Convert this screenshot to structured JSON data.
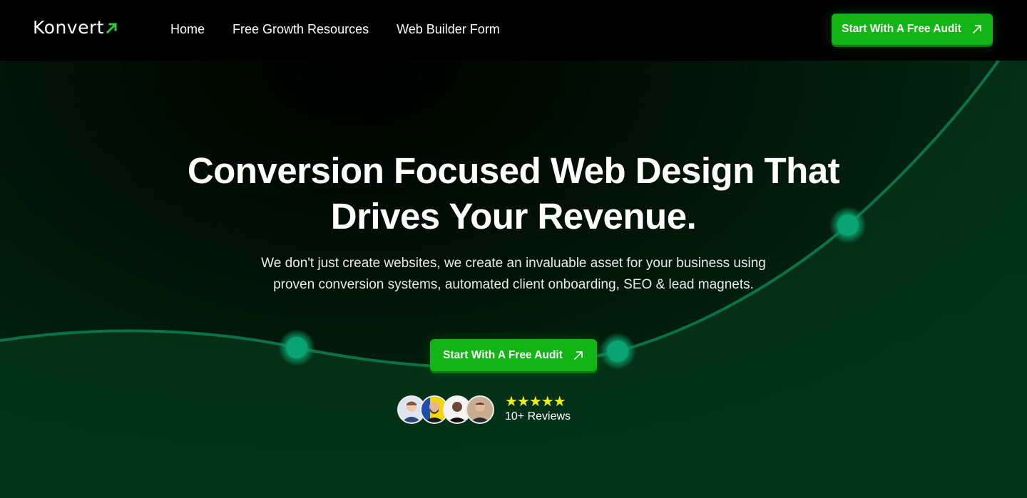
{
  "brand": {
    "name": "Konvert",
    "accent": "#12b515",
    "logo_arrow_color": "#2ecc40"
  },
  "nav": {
    "links": [
      "Home",
      "Free Growth Resources",
      "Web Builder Form"
    ],
    "cta_label": "Start With A Free Audit"
  },
  "hero": {
    "title_line1": "Conversion Focused Web Design That",
    "title_line2": "Drives Your Revenue.",
    "subtitle": "We don't just create websites, we create an invaluable asset for your business using proven conversion systems, automated client onboarding, SEO & lead magnets.",
    "cta_label": "Start With A Free Audit"
  },
  "reviews": {
    "stars": "★★★★★",
    "star_count": 5,
    "count_label": "10+ Reviews",
    "avatar_count": 4
  },
  "icons": {
    "cta_arrow": "arrow-up-right-icon",
    "logo_arrow": "arrow-up-right-icon"
  }
}
